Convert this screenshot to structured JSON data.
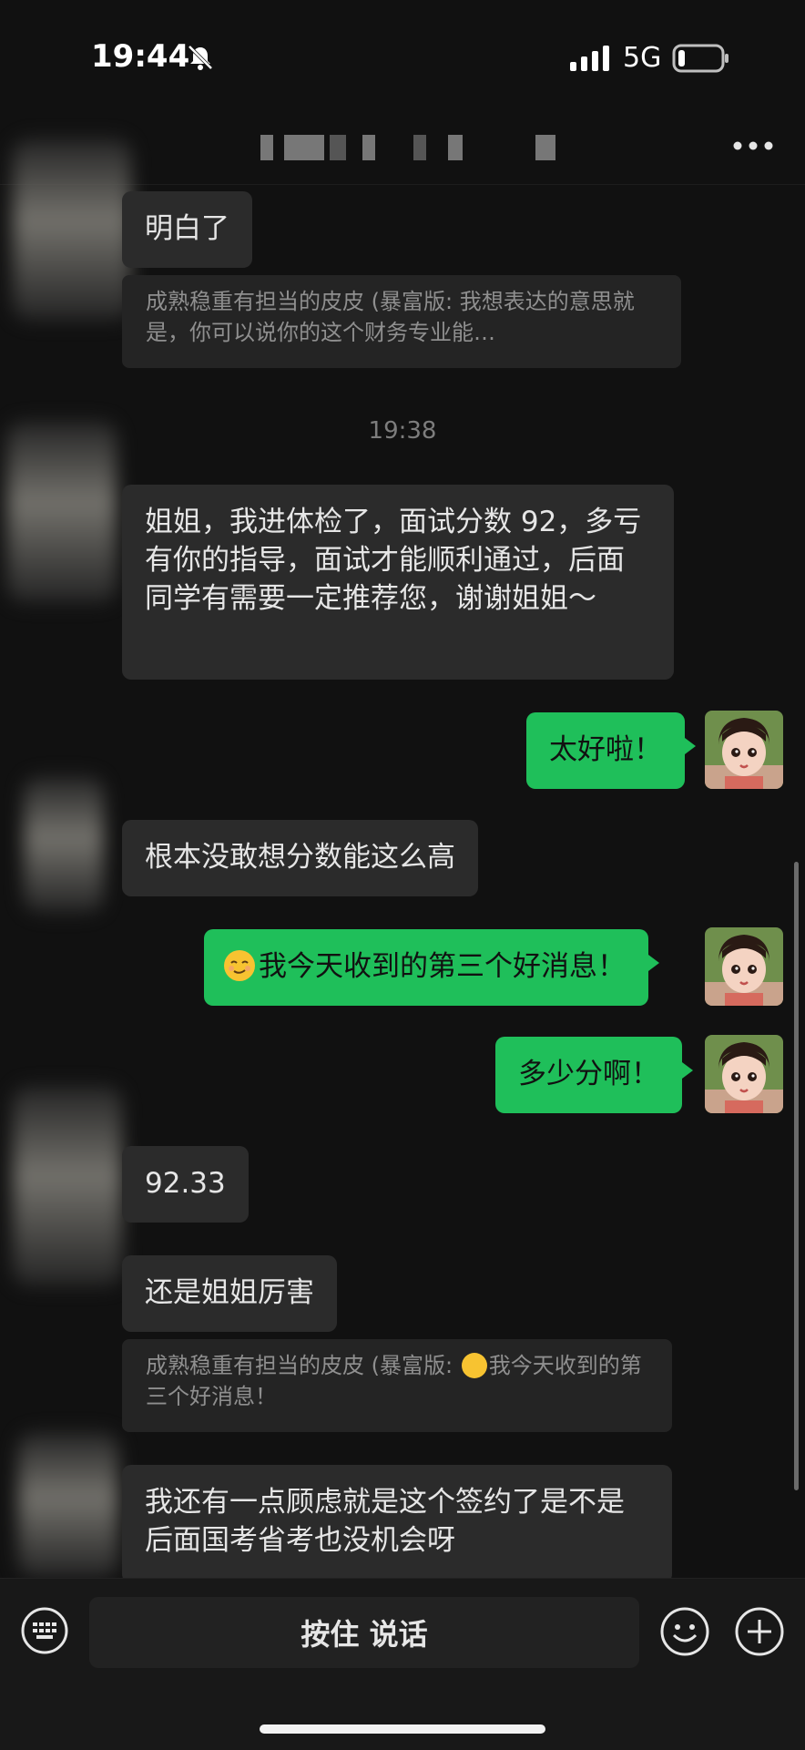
{
  "status": {
    "time": "19:44",
    "network": "5G"
  },
  "nav": {
    "more_icon": "more-icon"
  },
  "chat": {
    "timestamp": "19:38",
    "messages": {
      "m1": "明白了",
      "q1": "成熟稳重有担当的皮皮 (暴富版: 我想表达的意思就是，你可以说你的这个财务专业能…",
      "m2": "姐姐，我进体检了，面试分数 92，多亏有你的指导，面试才能顺利通过，后面同学有需要一定推荐您，谢谢姐姐～",
      "o1": "太好啦！",
      "m3": "根本没敢想分数能这么高",
      "o2": "我今天收到的第三个好消息！",
      "o3": "多少分啊！",
      "m4": "92.33",
      "m5": "还是姐姐厉害",
      "q2a": "成熟稳重有担当的皮皮 (暴富版: ",
      "q2b": "我今天收到的第三个好消息！",
      "m6": "我还有一点顾虑就是这个签约了是不是后面国考省考也没机会呀"
    }
  },
  "input": {
    "voice_label": "按住 说话"
  },
  "colors": {
    "outgoing": "#1fbf5a",
    "incoming": "#2b2b2b",
    "background": "#111111"
  }
}
